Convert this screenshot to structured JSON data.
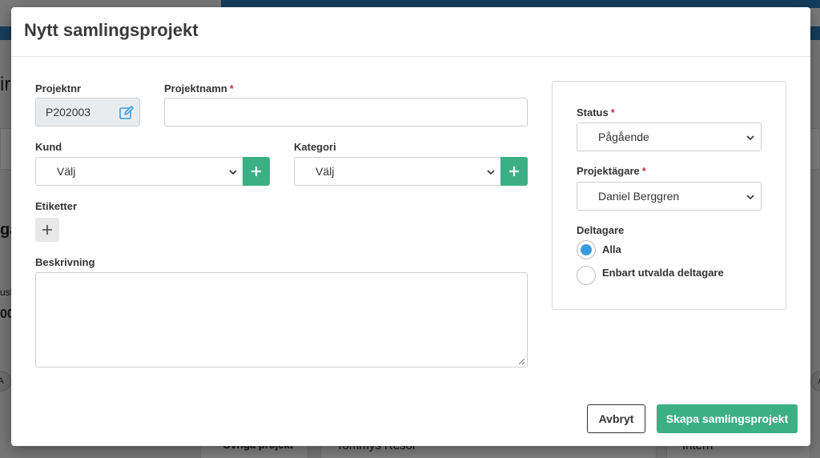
{
  "modal": {
    "title": "Nytt samlingsprojekt",
    "project_number": {
      "label": "Projektnr",
      "value": "P202003"
    },
    "project_name": {
      "label": "Projektnamn",
      "required_mark": "*",
      "value": ""
    },
    "customer": {
      "label": "Kund",
      "selected": "Välj"
    },
    "category": {
      "label": "Kategori",
      "selected": "Välj"
    },
    "tags": {
      "label": "Etiketter"
    },
    "description": {
      "label": "Beskrivning",
      "value": ""
    },
    "status": {
      "label": "Status",
      "required_mark": "*",
      "selected": "Pågående"
    },
    "owner": {
      "label": "Projektägare",
      "required_mark": "*",
      "selected": "Daniel Berggren"
    },
    "participants": {
      "label": "Deltagare",
      "options": [
        {
          "label": "Alla",
          "selected": true
        },
        {
          "label": "Enbart utvalda deltagare",
          "selected": false
        }
      ]
    },
    "buttons": {
      "cancel": "Avbryt",
      "submit": "Skapa samlingsprojekt"
    }
  },
  "background": {
    "snippets": [
      "ir",
      "gå",
      "usb",
      "00",
      "A",
      "A",
      "Övriga projekt",
      "Tommys Resor",
      "Intern"
    ]
  },
  "colors": {
    "accent_green": "#3daf84",
    "radio_blue": "#3a9de0",
    "required_red": "#d0344a",
    "topbar_blue": "#2a7ab8"
  }
}
